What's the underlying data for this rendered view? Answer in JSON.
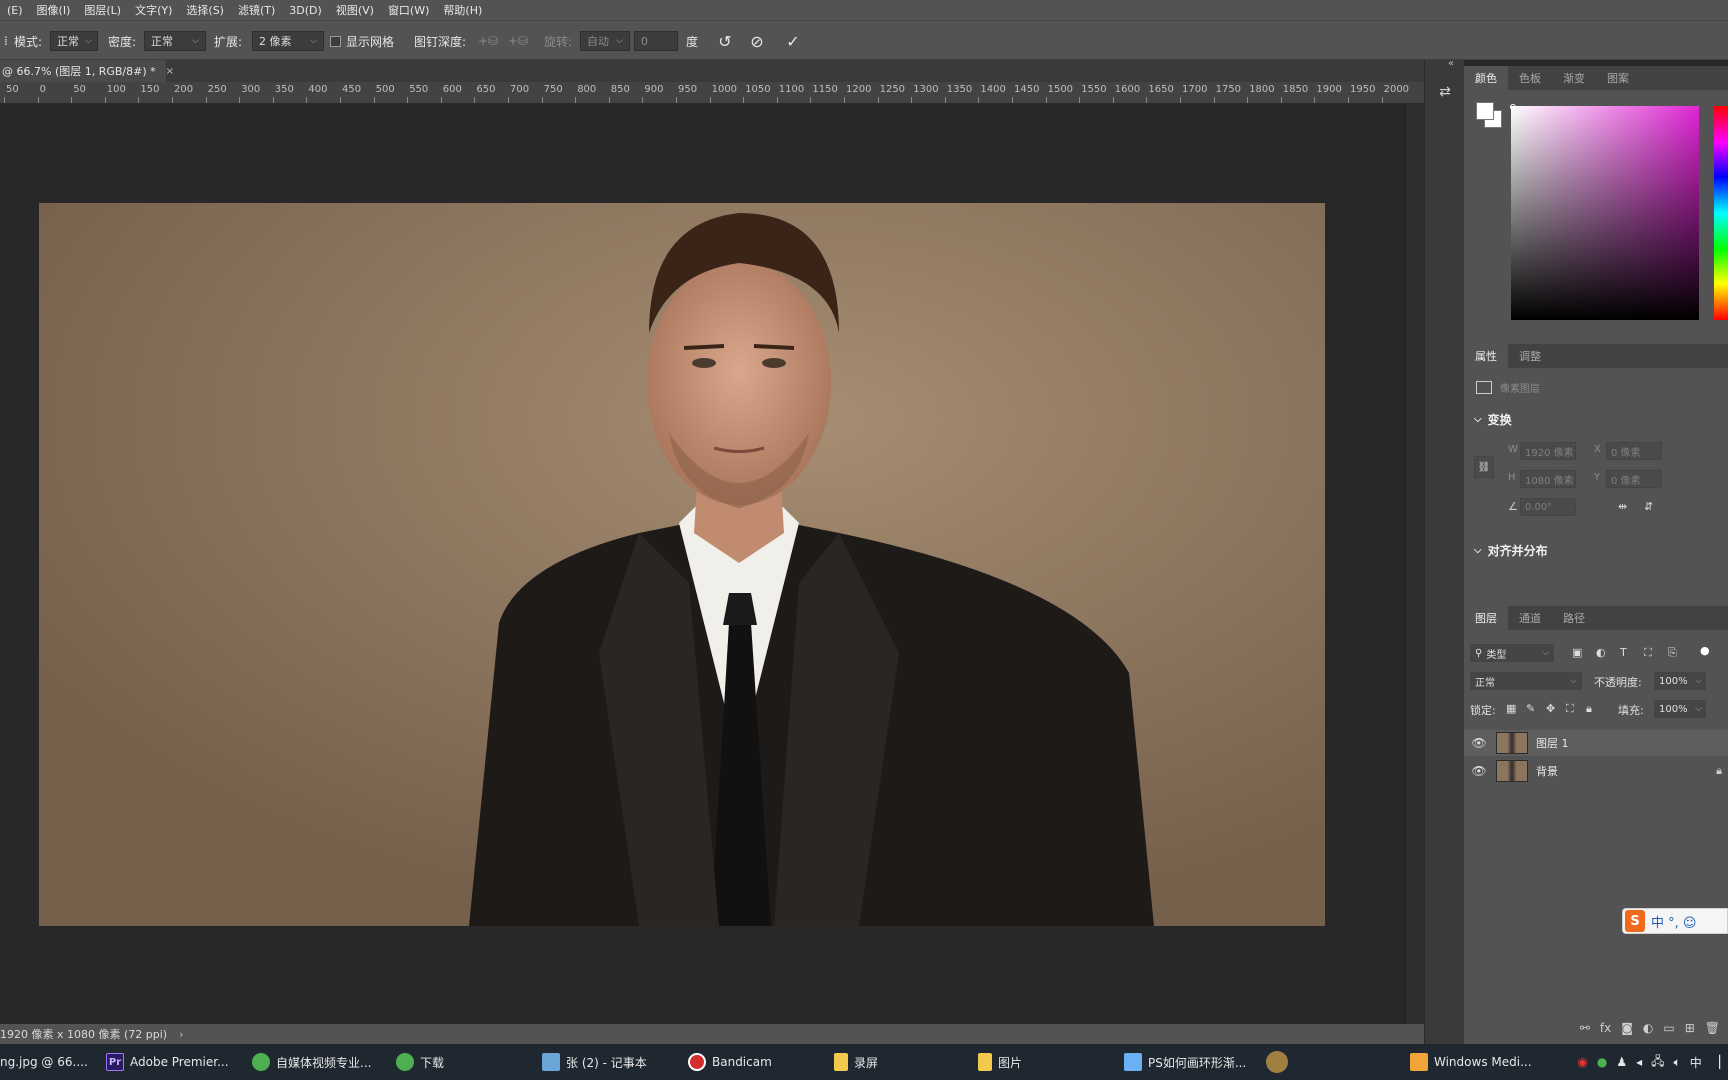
{
  "menu": [
    "(E)",
    "图像(I)",
    "图层(L)",
    "文字(Y)",
    "选择(S)",
    "滤镜(T)",
    "3D(D)",
    "视图(V)",
    "窗口(W)",
    "帮助(H)"
  ],
  "options": {
    "mode_label": "模式:",
    "mode_value": "正常",
    "density_label": "密度:",
    "density_value": "正常",
    "expand_label": "扩展:",
    "expand_value": "2 像素",
    "show_mesh": "显示网格",
    "pin_depth_label": "图钉深度:",
    "rotate_label": "旋转:",
    "rotate_value": "自动",
    "angle_value": "0",
    "degree": "度"
  },
  "doc_tab": {
    "title": "@ 66.7% (图层 1, RGB/8#) *",
    "close": "×"
  },
  "ruler": [
    "50",
    "0",
    "50",
    "100",
    "150",
    "200",
    "250",
    "300",
    "350",
    "400",
    "450",
    "500",
    "550",
    "600",
    "650",
    "700",
    "750",
    "800",
    "850",
    "900",
    "950",
    "1000",
    "1050",
    "1100",
    "1150",
    "1200",
    "1250",
    "1300",
    "1350",
    "1400",
    "1450",
    "1500",
    "1550",
    "1600",
    "1650",
    "1700",
    "1750",
    "1800",
    "1850",
    "1900",
    "1950",
    "2000"
  ],
  "status": "1920 像素 x 1080 像素 (72 ppi)",
  "status_arrow": "›",
  "color_panel": {
    "tabs": [
      "颜色",
      "色板",
      "渐变",
      "图案"
    ]
  },
  "properties": {
    "tabs": [
      "属性",
      "调整"
    ],
    "pixel_layer": "像素图层",
    "transform": "变换",
    "w_label": "W",
    "w": "1920 像素",
    "x_label": "X",
    "x": "0 像素",
    "h_label": "H",
    "h": "1080 像素",
    "y_label": "Y",
    "y": "0 像素",
    "angle": "0.00°",
    "align": "对齐并分布"
  },
  "layers": {
    "tabs": [
      "图层",
      "通道",
      "路径"
    ],
    "filter": "类型",
    "blend": "正常",
    "opacity_label": "不透明度:",
    "opacity": "100%",
    "lock_label": "锁定:",
    "fill_label": "填充:",
    "fill": "100%",
    "items": [
      {
        "name": "图层 1",
        "selected": true
      },
      {
        "name": "背景",
        "locked": true
      }
    ]
  },
  "ime": {
    "logo": "S",
    "text": "中 °, ☺"
  },
  "taskbar": [
    {
      "label": "ng.jpg @ 66....",
      "color": "#3a7bd5"
    },
    {
      "label": "Adobe Premier...",
      "color": "#2a1a5e",
      "icon": "Pr"
    },
    {
      "label": "自媒体视频专业...",
      "color": "#4caf50"
    },
    {
      "label": "下载",
      "color": "#4caf50"
    },
    {
      "label": "张 (2) - 记事本",
      "color": "#6aa7d8"
    },
    {
      "label": "Bandicam",
      "color": "#d32f2f"
    },
    {
      "label": "录屏",
      "color": "#f2c94c"
    },
    {
      "label": "图片",
      "color": "#f2c94c"
    },
    {
      "label": "PS如何画环形渐...",
      "color": "#6ab0f3"
    },
    {
      "label": "",
      "color": "#a08040"
    },
    {
      "label": "Windows Medi...",
      "color": "#f2a33a"
    }
  ],
  "tray_lang": "中"
}
